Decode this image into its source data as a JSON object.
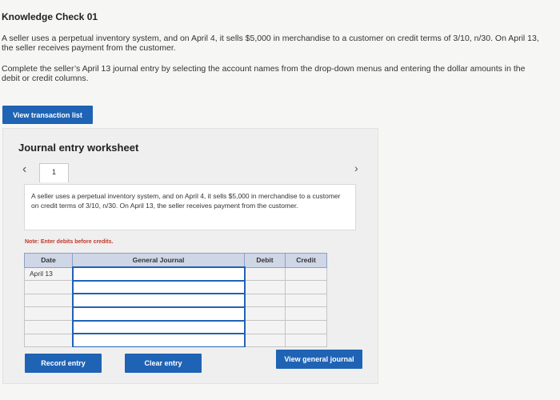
{
  "page": {
    "title": "Knowledge Check 01",
    "intro": "A seller uses a perpetual inventory system, and on April 4, it sells $5,000 in merchandise to a customer on credit terms of 3/10, n/30. On April 13, the seller receives payment from the customer.",
    "instructions": "Complete the seller’s April 13 journal entry by selecting the account names from the drop-down menus and entering the dollar amounts in the debit or credit columns.",
    "view_transaction_label": "View transaction list"
  },
  "worksheet": {
    "title": "Journal entry worksheet",
    "tab_number": "1",
    "description": "A seller uses a perpetual inventory system, and on April 4, it sells $5,000 in merchandise to a customer on credit terms of 3/10, n/30. On April 13, the seller receives payment from the customer.",
    "note": "Note: Enter debits before credits.",
    "columns": [
      "Date",
      "General Journal",
      "Debit",
      "Credit"
    ],
    "rows": [
      {
        "date": "April 13",
        "account": "",
        "debit": "",
        "credit": ""
      },
      {
        "date": "",
        "account": "",
        "debit": "",
        "credit": ""
      },
      {
        "date": "",
        "account": "",
        "debit": "",
        "credit": ""
      },
      {
        "date": "",
        "account": "",
        "debit": "",
        "credit": ""
      },
      {
        "date": "",
        "account": "",
        "debit": "",
        "credit": ""
      },
      {
        "date": "",
        "account": "",
        "debit": "",
        "credit": ""
      }
    ],
    "record_label": "Record entry",
    "clear_label": "Clear entry",
    "view_journal_label": "View general journal"
  },
  "colors": {
    "accent": "#1f63b5",
    "note": "#c0392b",
    "header_bg": "#cfd6e6"
  },
  "icons": {
    "prev": "chevron-left-icon",
    "next": "chevron-right-icon"
  }
}
